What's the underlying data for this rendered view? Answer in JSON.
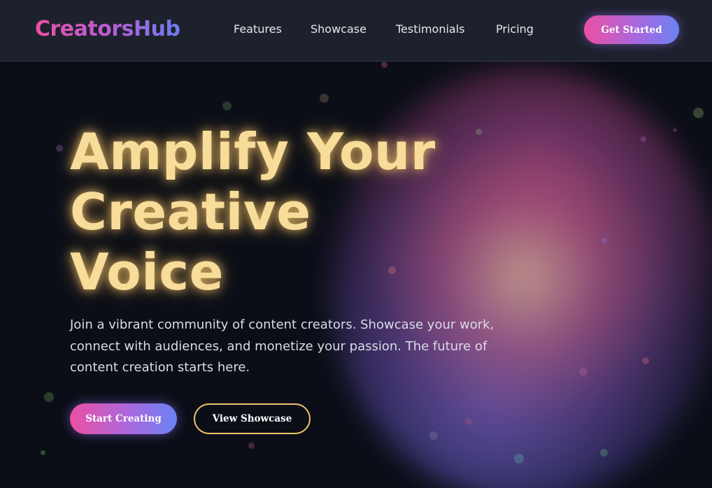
{
  "brand": {
    "name": "CreatorsHub",
    "gradient": [
      "#ec4fa6",
      "#b45fd6",
      "#6b7df3"
    ]
  },
  "nav": {
    "links": [
      {
        "label": "Features"
      },
      {
        "label": "Showcase"
      },
      {
        "label": "Testimonials"
      },
      {
        "label": "Pricing"
      }
    ],
    "cta_label": "Get Started"
  },
  "hero": {
    "title": "Amplify Your\nCreative\nVoice",
    "subtitle": "Join a vibrant community of content creators. Showcase your work, connect with audiences, and monetize your passion. The future of content creation starts here.",
    "primary_cta": "Start Creating",
    "secondary_cta": "View Showcase"
  },
  "colors": {
    "background": "#0b0e17",
    "navbar": "#1d212c",
    "title_glow": "#f7dc9a",
    "outline_button": "#f0c468",
    "accent_pink": "#ec4fa2",
    "accent_blue": "#6a82f4"
  }
}
